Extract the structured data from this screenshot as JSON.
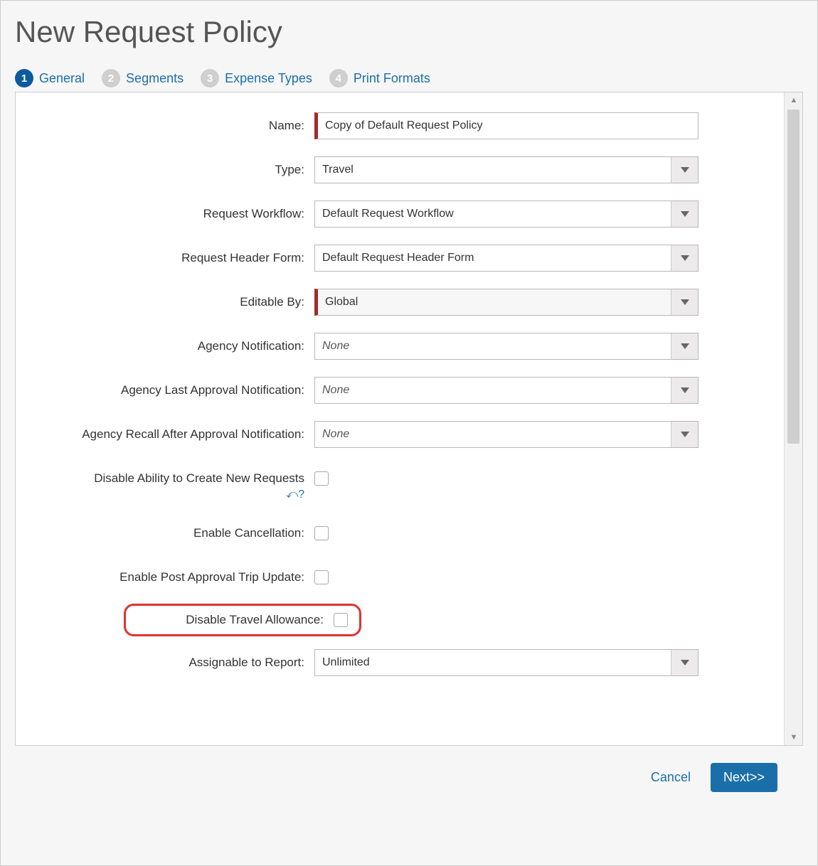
{
  "title": "New Request Policy",
  "steps": [
    {
      "num": "1",
      "label": "General",
      "active": true
    },
    {
      "num": "2",
      "label": "Segments",
      "active": false
    },
    {
      "num": "3",
      "label": "Expense Types",
      "active": false
    },
    {
      "num": "4",
      "label": "Print Formats",
      "active": false
    }
  ],
  "labels": {
    "name": "Name:",
    "type": "Type:",
    "workflow": "Request Workflow:",
    "headerForm": "Request Header Form:",
    "editableBy": "Editable By:",
    "agencyNotification": "Agency Notification:",
    "agencyLastApproval": "Agency Last Approval Notification:",
    "agencyRecall": "Agency Recall After Approval Notification:",
    "disableNew": "Disable Ability to Create New Requests",
    "enableCancel": "Enable Cancellation:",
    "enablePostApproval": "Enable Post Approval Trip Update:",
    "disableTravelAllowance": "Disable Travel Allowance:",
    "assignableToReport": "Assignable to Report:"
  },
  "values": {
    "name": "Copy of Default Request Policy",
    "type": "Travel",
    "workflow": "Default Request Workflow",
    "headerForm": "Default Request Header Form",
    "editableBy": "Global",
    "agencyNotification": "None",
    "agencyLastApproval": "None",
    "agencyRecall": "None",
    "assignableToReport": "Unlimited"
  },
  "help": {
    "cursor": "⤺?"
  },
  "footer": {
    "cancel": "Cancel",
    "next": "Next>>"
  }
}
